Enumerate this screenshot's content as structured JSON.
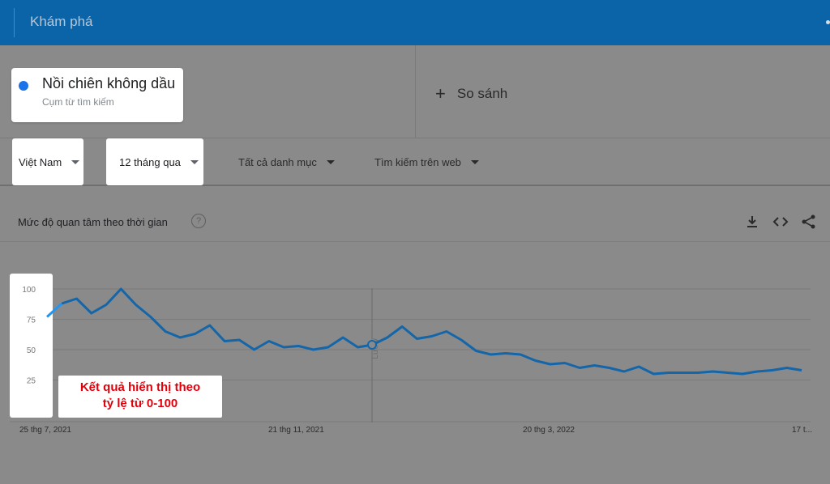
{
  "header": {
    "title": "Khám phá"
  },
  "search_term": {
    "name": "Nồi chiên không dầu",
    "type": "Cụm từ tìm kiếm",
    "color": "#1a73e8"
  },
  "compare": {
    "label": "So sánh",
    "icon": "plus-icon"
  },
  "filters": {
    "region": "Việt Nam",
    "time": "12 tháng qua",
    "category": "Tất cả danh mục",
    "search_type": "Tìm kiếm trên web"
  },
  "panel": {
    "title": "Mức độ quan tâm theo thời gian",
    "icons": [
      "help-icon",
      "download-icon",
      "embed-icon",
      "share-icon"
    ]
  },
  "note": {
    "line1": "Kết quả hiển thị theo",
    "line2": "tỷ lệ từ 0-100"
  },
  "chart_data": {
    "type": "line",
    "y_ticks": [
      "100",
      "75",
      "50",
      "25"
    ],
    "ylim": [
      0,
      100
    ],
    "x_ticks": [
      "25 thg 7, 2021",
      "21 thg 11, 2021",
      "20 thg 3, 2022",
      "17 t..."
    ],
    "hover_label": "Lưu ý",
    "series": [
      {
        "values": [
          77,
          88,
          92,
          80,
          87,
          100,
          87,
          77,
          65,
          60,
          63,
          70,
          57,
          58,
          50,
          57,
          52,
          53,
          50,
          52,
          60,
          52,
          54,
          60,
          69,
          59,
          61,
          65,
          58,
          49,
          46,
          47,
          46,
          41,
          38,
          39,
          35,
          37,
          35,
          32,
          36,
          30,
          31,
          31,
          31,
          32,
          31,
          30,
          32,
          33,
          35,
          33
        ]
      }
    ],
    "color": "#1566a8",
    "grid": true
  }
}
